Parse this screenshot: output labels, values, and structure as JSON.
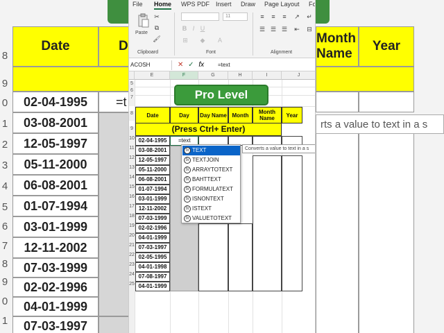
{
  "background": {
    "headers": [
      "Date",
      "D",
      "Month Name",
      "Year"
    ],
    "dates": [
      "02-04-1995",
      "03-08-2001",
      "12-05-1997",
      "05-11-2000",
      "06-08-2001",
      "01-07-1994",
      "03-01-1999",
      "12-11-2002",
      "07-03-1999",
      "02-02-1996",
      "04-01-1999",
      "07-03-1997"
    ],
    "row_numbers": [
      "8",
      "9",
      "0",
      "1",
      "2",
      "3",
      "4",
      "5",
      "6",
      "7",
      "8",
      "9",
      "0",
      "1"
    ],
    "formula_fragment": "=t",
    "tooltip_fragment": "rts a value to text in a s"
  },
  "menu": {
    "items": [
      "File",
      "Home",
      "WPS PDF",
      "Insert",
      "Draw",
      "Page Layout",
      "Fo"
    ],
    "active": "Home"
  },
  "ribbon": {
    "clipboard_label": "Clipboard",
    "paste_label": "Paste",
    "font_label": "Font",
    "alignment_label": "Alignment",
    "font_size": "11",
    "bold": "B",
    "italic": "I",
    "underline": "U"
  },
  "formula_bar": {
    "name_box": "ACOSH",
    "cancel": "✕",
    "confirm": "✓",
    "fx": "fx",
    "formula": "=text"
  },
  "columns": [
    "E",
    "F",
    "G",
    "H",
    "I",
    "J"
  ],
  "row_numbers": [
    "5",
    "6",
    "7",
    "8",
    "9",
    "10",
    "11",
    "12",
    "13",
    "14",
    "15",
    "16",
    "17",
    "18",
    "19",
    "20",
    "21",
    "22",
    "23",
    "24",
    "25"
  ],
  "title_box": "Pro Level",
  "table": {
    "headers": [
      "Date",
      "Day",
      "Day Name",
      "Month",
      "Month Name",
      "Year"
    ],
    "banner": "(Press Ctrl+ Enter)",
    "dates": [
      "02-04-1995",
      "03-08-2001",
      "12-05-1997",
      "05-11-2000",
      "06-08-2001",
      "01-07-1994",
      "03-01-1999",
      "12-11-2002",
      "07-03-1999",
      "02-02-1996",
      "04-01-1999",
      "07-03-1997",
      "02-05-1995",
      "04-01-1998",
      "07-08-1997",
      "04-01-1999"
    ],
    "active_input": "=text"
  },
  "autocomplete": {
    "items": [
      "TEXT",
      "TEXTJOIN",
      "ARRAYTOTEXT",
      "BAHTTEXT",
      "FORMULATEXT",
      "ISNONTEXT",
      "ISTEXT",
      "VALUETOTEXT"
    ],
    "selected_index": 0,
    "tooltip": "Converts a value to text in a s"
  },
  "colors": {
    "header_yellow": "#ffff00",
    "title_green": "#3b9b3b",
    "selection_blue": "#0a64c8",
    "excel_green": "#217346"
  }
}
